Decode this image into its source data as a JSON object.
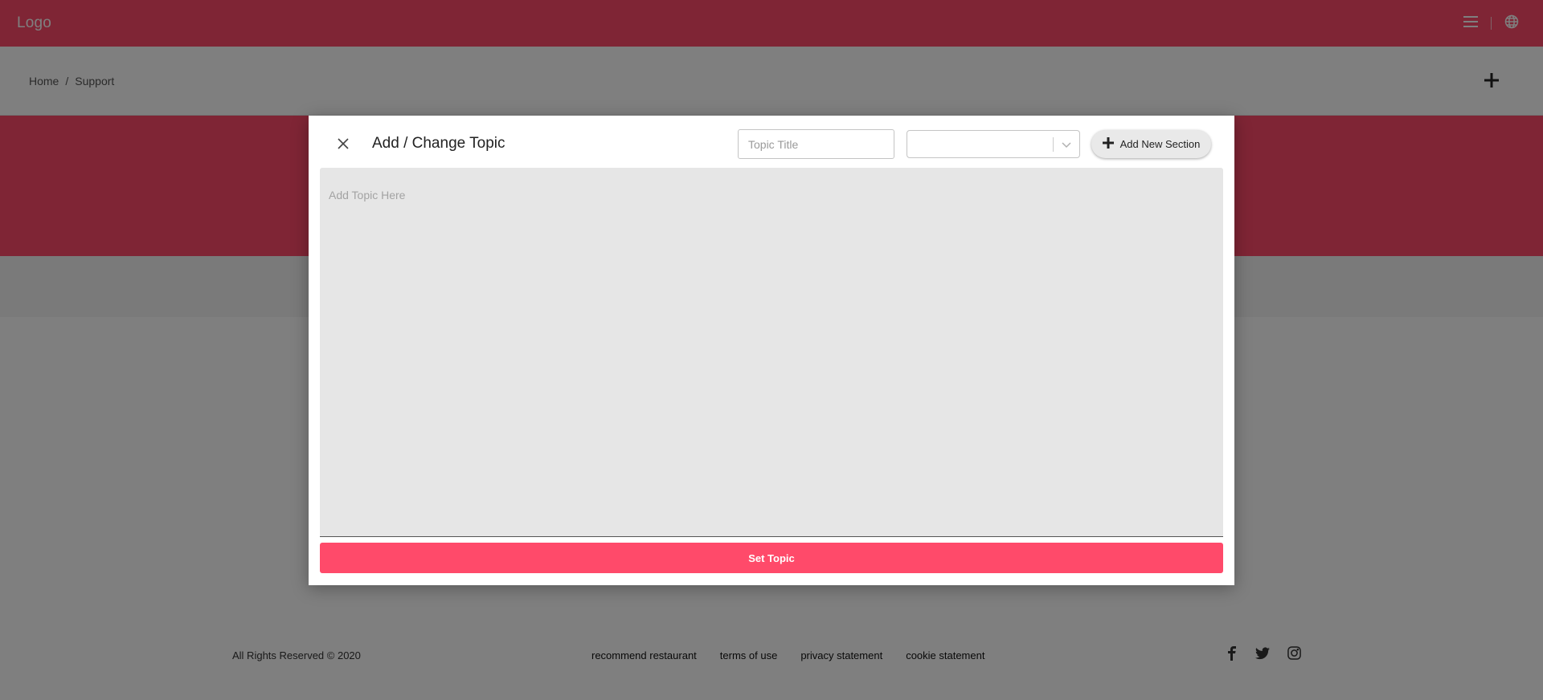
{
  "header": {
    "logo_text": "Logo",
    "icons": [
      "menu-icon",
      "globe-icon"
    ]
  },
  "breadcrumb": {
    "items": [
      "Home",
      "Support"
    ],
    "separator": "/"
  },
  "subbar": {
    "add_icon": "plus-icon"
  },
  "modal": {
    "title": "Add / Change Topic",
    "close_icon": "close-icon",
    "topic_title_placeholder": "Topic Title",
    "topic_title_value": "",
    "section_select_value": "",
    "add_section_label": "Add New Section",
    "topic_body_placeholder": "Add Topic Here",
    "submit_label": "Set Topic"
  },
  "footer": {
    "copyright": "All Rights Reserved © 2020",
    "links": [
      "recommend restaurant",
      "terms of use",
      "privacy statement",
      "cookie statement"
    ],
    "social_icons": [
      "facebook-icon",
      "twitter-icon",
      "instagram-icon"
    ]
  },
  "colors": {
    "accent": "#ff4a6a",
    "overlay": "rgba(0,0,0,0.5)"
  }
}
